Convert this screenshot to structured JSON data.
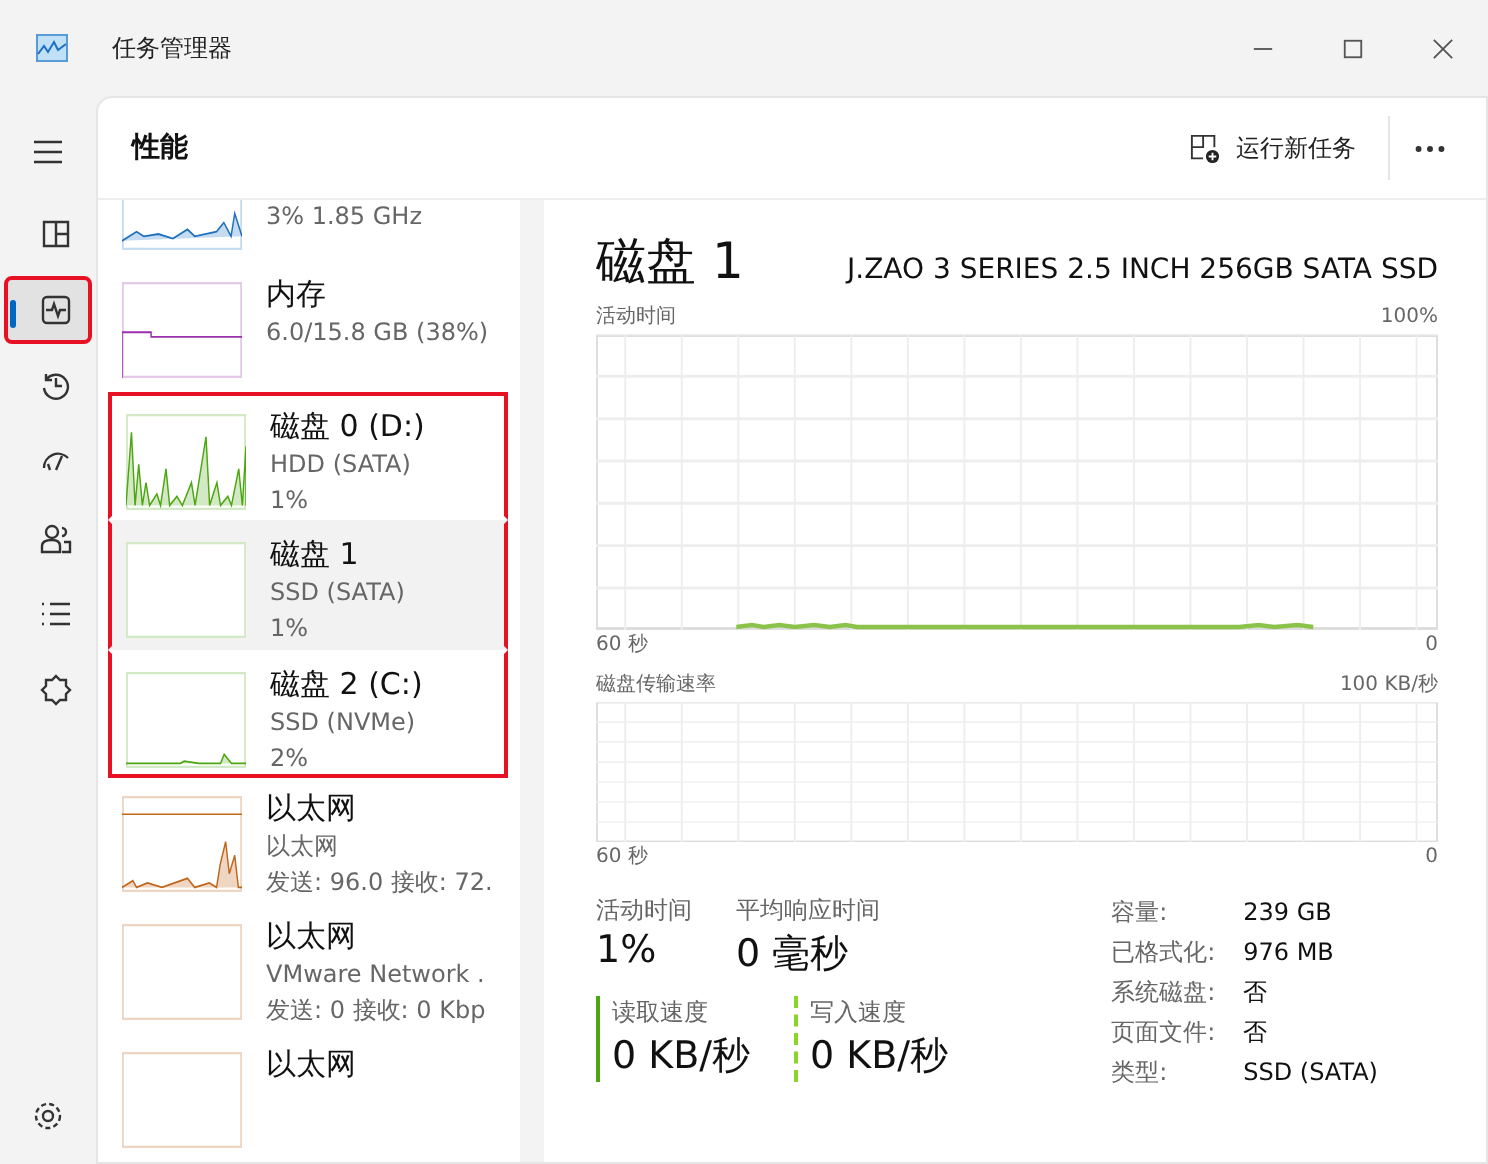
{
  "window": {
    "title": "任务管理器"
  },
  "nav": [
    {
      "kind": "processes",
      "selected": false,
      "highlighted": false
    },
    {
      "kind": "performance",
      "selected": true,
      "highlighted": true
    },
    {
      "kind": "history",
      "selected": false,
      "highlighted": false
    },
    {
      "kind": "startup",
      "selected": false,
      "highlighted": false
    },
    {
      "kind": "users",
      "selected": false,
      "highlighted": false
    },
    {
      "kind": "details",
      "selected": false,
      "highlighted": false
    },
    {
      "kind": "services",
      "selected": false,
      "highlighted": false
    }
  ],
  "page": {
    "title": "性能",
    "run_task": "运行新任务"
  },
  "devices": [
    {
      "kind": "cpu",
      "lines": [
        "3% 1.85 GHz"
      ],
      "selected": false,
      "highlighted": false
    },
    {
      "kind": "memory",
      "name": "内存",
      "lines": [
        "6.0/15.8 GB (38%)"
      ],
      "selected": false,
      "highlighted": false
    },
    {
      "kind": "disk",
      "name": "磁盘 0 (D:)",
      "lines": [
        "HDD (SATA)",
        "1%"
      ],
      "selected": false,
      "highlighted": true
    },
    {
      "kind": "disk",
      "name": "磁盘 1",
      "lines": [
        "SSD (SATA)",
        "1%"
      ],
      "selected": true,
      "highlighted": true
    },
    {
      "kind": "disk",
      "name": "磁盘 2 (C:)",
      "lines": [
        "SSD (NVMe)",
        "2%"
      ],
      "selected": false,
      "highlighted": true
    },
    {
      "kind": "ethernet",
      "name": "以太网",
      "lines": [
        "以太网",
        "发送: 96.0 接收: 72."
      ],
      "selected": false,
      "highlighted": false
    },
    {
      "kind": "ethernet",
      "name": "以太网",
      "lines": [
        "VMware Network .",
        "发送: 0 接收: 0 Kbp"
      ],
      "selected": false,
      "highlighted": false
    },
    {
      "kind": "ethernet",
      "name": "以太网",
      "selected": false,
      "highlighted": false
    }
  ],
  "detail": {
    "title": "磁盘 1",
    "model": "J.ZAO 3 SERIES 2.5 INCH 256GB SATA SSD",
    "chart1": {
      "label": "活动时间",
      "max": "100%",
      "time": "60 秒",
      "min": "0"
    },
    "chart2": {
      "label": "磁盘传输速率",
      "max": "100 KB/秒",
      "time": "60 秒",
      "min": "0"
    },
    "stats": [
      {
        "label": "活动时间",
        "value": "1%"
      },
      {
        "label": "平均响应时间",
        "value": "0 毫秒"
      }
    ],
    "speeds": [
      {
        "label": "读取速度",
        "value": "0 KB/秒",
        "kind": "solid"
      },
      {
        "label": "写入速度",
        "value": "0 KB/秒",
        "kind": "dashed"
      }
    ],
    "props": [
      {
        "label": "容量:",
        "value": "239 GB"
      },
      {
        "label": "已格式化:",
        "value": "976 MB"
      },
      {
        "label": "系统磁盘:",
        "value": "否"
      },
      {
        "label": "页面文件:",
        "value": "否"
      },
      {
        "label": "类型:",
        "value": "SSD (SATA)"
      }
    ]
  }
}
